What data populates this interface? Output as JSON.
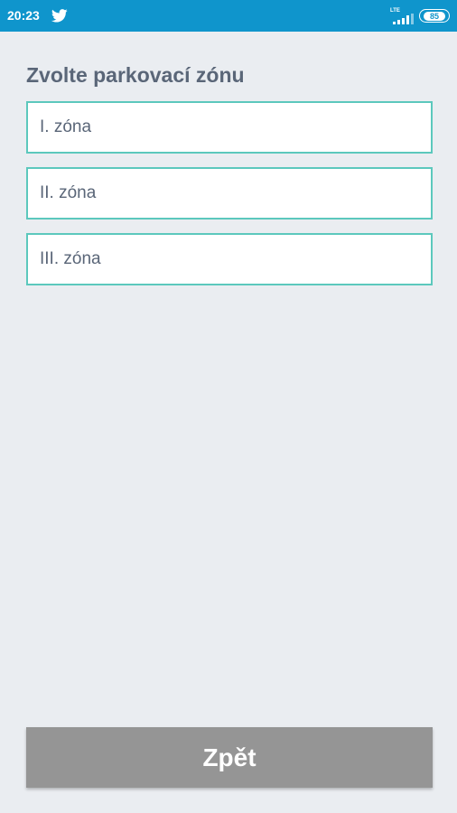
{
  "status_bar": {
    "time": "20:23",
    "notification_icon": "twitter-icon",
    "network_label": "LTE",
    "signal_icon": "signal-icon",
    "battery_level": "85",
    "background_color": "#0f95cc"
  },
  "main": {
    "title": "Zvolte parkovací zónu",
    "zones": [
      {
        "label": "I. zóna"
      },
      {
        "label": "II. zóna"
      },
      {
        "label": "III. zóna"
      }
    ],
    "zone_border_color": "#5cc8bd"
  },
  "footer": {
    "back_label": "Zpět",
    "back_color": "#959595"
  }
}
